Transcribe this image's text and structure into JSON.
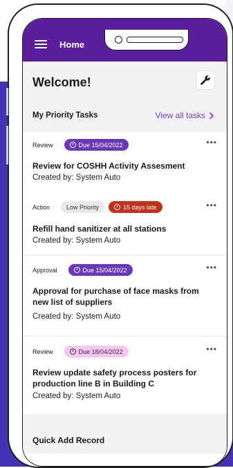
{
  "header": {
    "title": "Home"
  },
  "welcome": "Welcome!",
  "priority": {
    "section_title": "My Priority Tasks",
    "view_all": "View all tasks"
  },
  "tasks": [
    {
      "type": "Review",
      "due": "Due 15/04/2022",
      "title": "Review for COSHH Activity Assesment",
      "created": "Created by: System Auto"
    },
    {
      "type": "Action",
      "priority": "Low Priority",
      "late": "15 days late",
      "title": "Refill hand sanitizer at all stations",
      "created": "Created by: System Auto"
    },
    {
      "type": "Approval",
      "due": "Due 15/04/2022",
      "title": "Approval for purchase of face masks from new list of suppliers",
      "created": "Created by: System Auto"
    },
    {
      "type": "Review",
      "due": "Due 18/04/2022",
      "title": "Review update safety process posters for production line B in Building C",
      "created": "Created by: System Auto"
    }
  ],
  "more_icon": "•••",
  "quick_add": "Quick Add Record",
  "colors": {
    "header": "#5b1f9e",
    "accent": "#7a3cc0",
    "late": "#c4301a",
    "background": "#4432b4"
  },
  "icons": [
    "menu-icon",
    "wrench-icon",
    "chevron-right-icon",
    "clock-icon",
    "more-icon"
  ]
}
